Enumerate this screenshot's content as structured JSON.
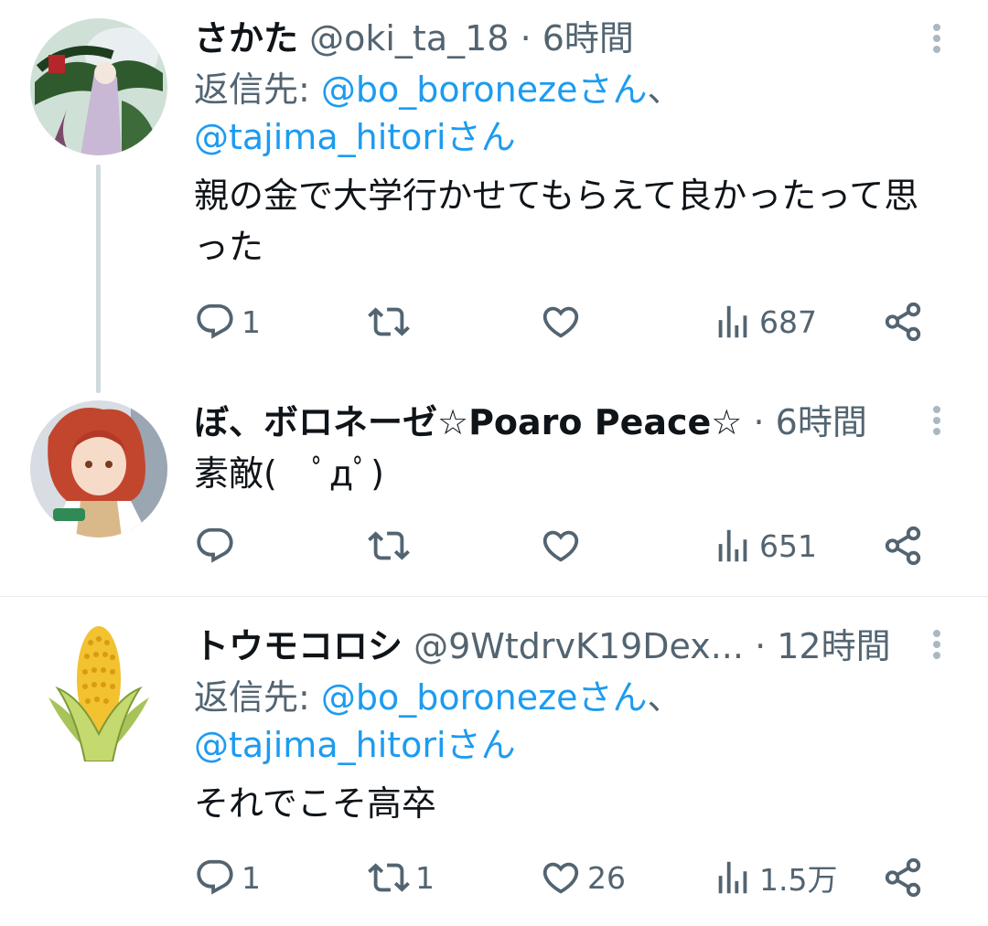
{
  "tweets": [
    {
      "name": "さかた",
      "handle": "@oki_ta_18",
      "dot": "·",
      "time": "6時間",
      "reply_prefix": "返信先: ",
      "reply_m1": "@bo_boronezeさん",
      "reply_sep": "、",
      "reply_m2": "@tajima_hitoriさん",
      "text": "親の金で大学行かせてもらえて良かったって思った",
      "replies": "1",
      "retweets": "",
      "likes": "",
      "views": "687"
    },
    {
      "name": "ぼ、ボロネーゼ☆Poaro Peace☆",
      "dot": "·",
      "time": "6時間",
      "text": "素敵(　ﾟдﾟ)",
      "replies": "",
      "retweets": "",
      "likes": "",
      "views": "651"
    },
    {
      "name": "トウモコロシ",
      "handle": "@9WtdrvK19Dex...",
      "dot": "·",
      "time": "12時間",
      "reply_prefix": "返信先: ",
      "reply_m1": "@bo_boronezeさん",
      "reply_sep": "、",
      "reply_m2": "@tajima_hitoriさん",
      "text": "それでこそ高卒",
      "replies": "1",
      "retweets": "1",
      "likes": "26",
      "views": "1.5万"
    }
  ],
  "icons": [
    "reply-icon",
    "retweet-icon",
    "like-icon",
    "views-icon",
    "share-icon",
    "more-icon"
  ],
  "colors": {
    "mention": "#1d9bf0",
    "secondary": "#536471",
    "text": "#0f1419"
  }
}
